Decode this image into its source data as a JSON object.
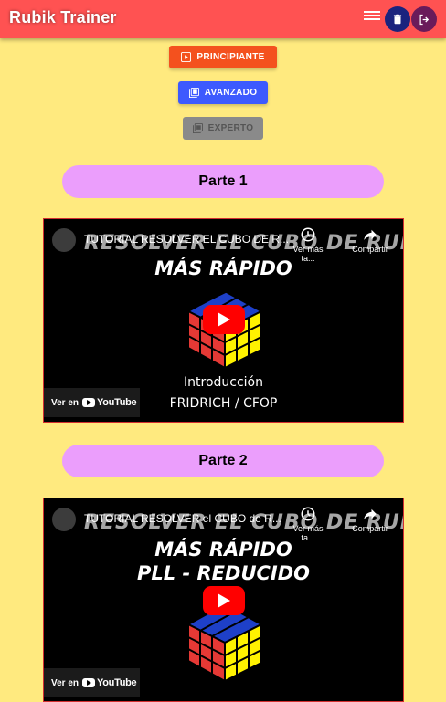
{
  "app": {
    "title": "Rubik Trainer"
  },
  "colors": {
    "appbar": "#ff5252",
    "background": "#ffea7f",
    "pill": "#eb9efc",
    "principiante": "#f4511e",
    "avanzado": "#3d5afe",
    "experto": "#8a8a8a"
  },
  "levels": [
    {
      "label": "PRINCIPIANTE",
      "icon": "play-library-icon"
    },
    {
      "label": "AVANZADO",
      "icon": "library-icon"
    },
    {
      "label": "EXPERTO",
      "icon": "library-icon",
      "disabled": true
    }
  ],
  "sections": [
    {
      "title": "Parte 1",
      "video": {
        "channel_title": "TUTORIAL RESOLVER EL CUBO DE R...",
        "overlay_title": "RESOLVER EL CUBO DE RUBIK",
        "line1": "MÁS RÁPIDO",
        "line2": "",
        "intro": "Introducción",
        "method": "FRIDRICH / CFOP",
        "watch_later": "Ver más ta...",
        "share": "Compartir",
        "watch_on": "Ver en",
        "youtube": "YouTube"
      }
    },
    {
      "title": "Parte 2",
      "video": {
        "channel_title": "TUTORIAL RESOLVER el CUBO de R...",
        "overlay_title": "RESOLVER EL CUBO DE RUBIK",
        "line1": "MÁS RÁPIDO",
        "line2": "PLL - REDUCIDO",
        "watch_later": "Ver más ta...",
        "share": "Compartir",
        "watch_on": "Ver en",
        "youtube": "YouTube"
      }
    }
  ]
}
